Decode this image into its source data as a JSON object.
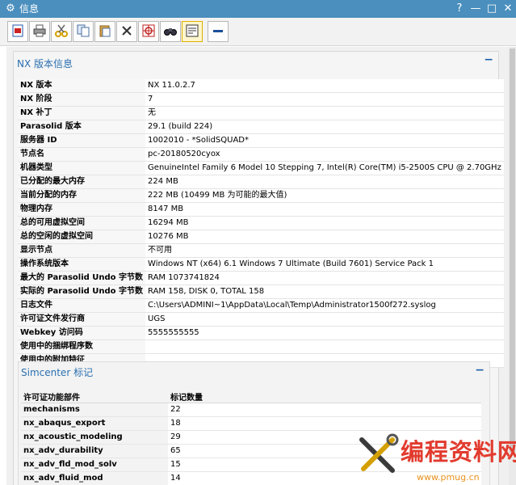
{
  "window": {
    "title": "信息",
    "controls": {
      "help": "?",
      "minimize": "—",
      "maximize": "□",
      "close": "✕"
    }
  },
  "toolbar": {
    "buttons": [
      {
        "icon": "properties-icon"
      },
      {
        "icon": "print-icon"
      },
      {
        "icon": "cut-icon"
      },
      {
        "icon": "copy-icon"
      },
      {
        "icon": "paste-icon"
      },
      {
        "icon": "delete-icon"
      },
      {
        "icon": "target-icon"
      },
      {
        "icon": "binoculars-icon"
      },
      {
        "icon": "wrap-text-icon"
      },
      {
        "icon": "collapse-icon"
      }
    ]
  },
  "nx_section": {
    "title": "NX 版本信息",
    "collapse": "−",
    "rows": [
      {
        "key": "NX 版本",
        "value": "NX 11.0.2.7"
      },
      {
        "key": "NX 阶段",
        "value": "7"
      },
      {
        "key": "NX 补丁",
        "value": "无"
      },
      {
        "key": "Parasolid 版本",
        "value": "29.1 (build 224)"
      },
      {
        "key": "服务器 ID",
        "value": "1002010 - *SolidSQUAD*"
      },
      {
        "key": "节点名",
        "value": "pc-20180520cyox"
      },
      {
        "key": "机器类型",
        "value": "GenuineIntel Family 6 Model 10 Stepping 7, Intel(R) Core(TM) i5-2500S CPU @ 2.70GHz"
      },
      {
        "key": "已分配的最大内存",
        "value": "224 MB"
      },
      {
        "key": "当前分配的内存",
        "value": "222 MB (10499 MB 为可能的最大值)"
      },
      {
        "key": "物理内存",
        "value": "8147 MB"
      },
      {
        "key": "总的可用虚拟空间",
        "value": "16294 MB"
      },
      {
        "key": "总的空闲的虚拟空间",
        "value": "10276 MB"
      },
      {
        "key": "显示节点",
        "value": "不可用"
      },
      {
        "key": "操作系统版本",
        "value": "Windows NT (x64) 6.1 Windows 7 Ultimate (Build 7601) Service Pack 1"
      },
      {
        "key": "最大的 Parasolid Undo 字节数",
        "value": "RAM 1073741824"
      },
      {
        "key": "实际的 Parasolid Undo 字节数",
        "value": "RAM 158, DISK 0, TOTAL 158"
      },
      {
        "key": "日志文件",
        "value": "C:\\Users\\ADMINI~1\\AppData\\Local\\Temp\\Administrator1500f272.syslog"
      },
      {
        "key": "许可证文件发行商",
        "value": "UGS"
      },
      {
        "key": "Webkey 访问码",
        "value": "5555555555"
      },
      {
        "key": "使用中的捆绑程序数",
        "value": ""
      },
      {
        "key": "使用中的附加特征",
        "value": ""
      }
    ]
  },
  "simcenter_section": {
    "title": "Simcenter 标记",
    "collapse": "−",
    "headers": {
      "feature": "许可证功能部件",
      "count": "标记数量"
    },
    "rows": [
      {
        "key": "mechanisms",
        "value": "22"
      },
      {
        "key": "nx_abaqus_export",
        "value": "18"
      },
      {
        "key": "nx_acoustic_modeling",
        "value": "29"
      },
      {
        "key": "nx_adv_durability",
        "value": "65"
      },
      {
        "key": "nx_adv_fld_mod_solv",
        "value": "15"
      },
      {
        "key": "nx_adv_fluid_mod",
        "value": "14"
      }
    ]
  },
  "watermark": {
    "text": "编程资料网",
    "url": "www.pmug.cn"
  },
  "colors": {
    "titlebar": "#4a8fbe",
    "section_title": "#2a6fb0",
    "watermark": "#e23b2e"
  }
}
